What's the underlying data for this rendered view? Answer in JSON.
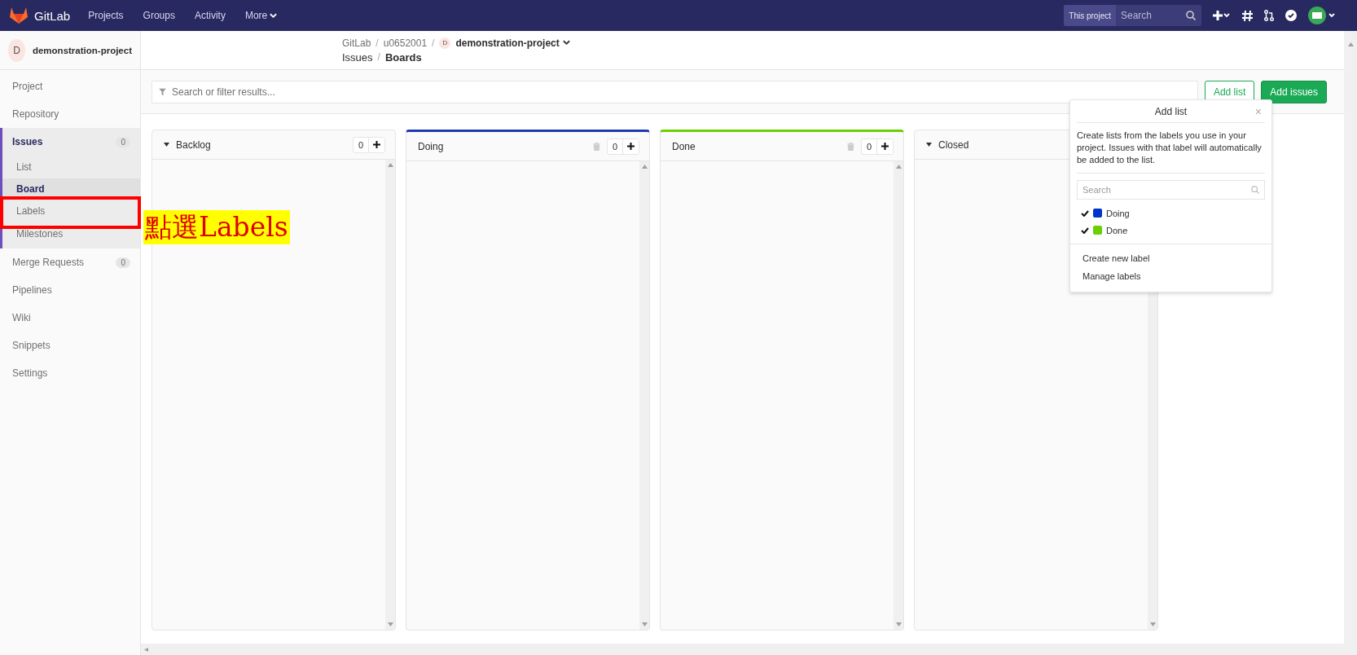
{
  "topbar": {
    "brand": "GitLab",
    "nav": [
      {
        "label": "Projects",
        "dropdown": false
      },
      {
        "label": "Groups",
        "dropdown": false
      },
      {
        "label": "Activity",
        "dropdown": false
      },
      {
        "label": "More",
        "dropdown": true
      }
    ],
    "search_scope": "This project",
    "search": {
      "placeholder": "Search"
    }
  },
  "sidebar": {
    "project_initial": "D",
    "project_name": "demonstration-project",
    "items": [
      {
        "label": "Project",
        "selected": false
      },
      {
        "label": "Repository",
        "selected": false
      },
      {
        "label": "Issues",
        "selected": true,
        "count": "0",
        "children": [
          {
            "label": "List",
            "selected": false
          },
          {
            "label": "Board",
            "selected": true
          },
          {
            "label": "Labels",
            "selected": false
          },
          {
            "label": "Milestones",
            "selected": false
          }
        ]
      },
      {
        "label": "Merge Requests",
        "selected": false,
        "count": "0"
      },
      {
        "label": "Pipelines",
        "selected": false
      },
      {
        "label": "Wiki",
        "selected": false
      },
      {
        "label": "Snippets",
        "selected": false
      },
      {
        "label": "Settings",
        "selected": false
      }
    ]
  },
  "breadcrumb": {
    "separator": "/",
    "path": [
      "GitLab",
      "u0652001"
    ],
    "project_initial": "D",
    "project": "demonstration-project",
    "section": "Issues",
    "page": "Boards"
  },
  "filter": {
    "placeholder": "Search or filter results..."
  },
  "buttons": {
    "add_list": "Add list",
    "add_issues": "Add issues"
  },
  "columns": [
    {
      "title": "Backlog",
      "kind": "default",
      "count": "0"
    },
    {
      "title": "Doing",
      "kind": "label",
      "color": "#1f3ab0",
      "count": "0"
    },
    {
      "title": "Done",
      "kind": "label",
      "color": "#69d100",
      "count": "0"
    },
    {
      "title": "Closed",
      "kind": "default"
    }
  ],
  "add_list_dropdown": {
    "title": "Add list",
    "close": "×",
    "description": "Create lists from the labels you use in your project. Issues with that label will automatically be added to the list.",
    "search": {
      "placeholder": "Search"
    },
    "labels": [
      {
        "name": "Doing",
        "color": "#0033cc",
        "checked": true
      },
      {
        "name": "Done",
        "color": "#69d100",
        "checked": true
      }
    ],
    "links": [
      "Create new label",
      "Manage labels"
    ]
  },
  "annotation": {
    "text": "點選Labels"
  }
}
